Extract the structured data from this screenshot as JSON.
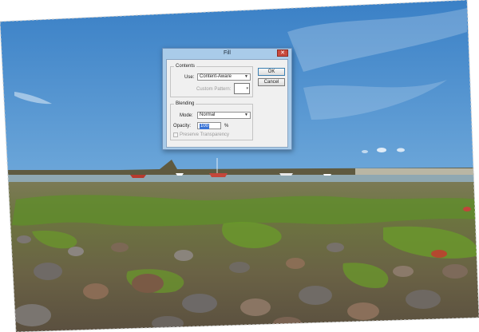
{
  "dialog": {
    "title": "Fill",
    "close_icon": "close-icon",
    "contents": {
      "group_label": "Contents",
      "use_label": "Use:",
      "use_value": "Content-Aware",
      "custom_pattern_label": "Custom Pattern:"
    },
    "blending": {
      "group_label": "Blending",
      "mode_label": "Mode:",
      "mode_value": "Normal",
      "opacity_label": "Opacity:",
      "opacity_value": "100",
      "opacity_unit": "%",
      "preserve_label": "Preserve Transparency"
    },
    "ok_label": "OK",
    "cancel_label": "Cancel"
  },
  "colors": {
    "sky_top": "#3f86c9",
    "sky_horizon": "#b7d3ea",
    "dialog_frame": "#a9cbe9",
    "algae_green": "#5f8f2a",
    "selection_blue": "#3a74d6"
  }
}
